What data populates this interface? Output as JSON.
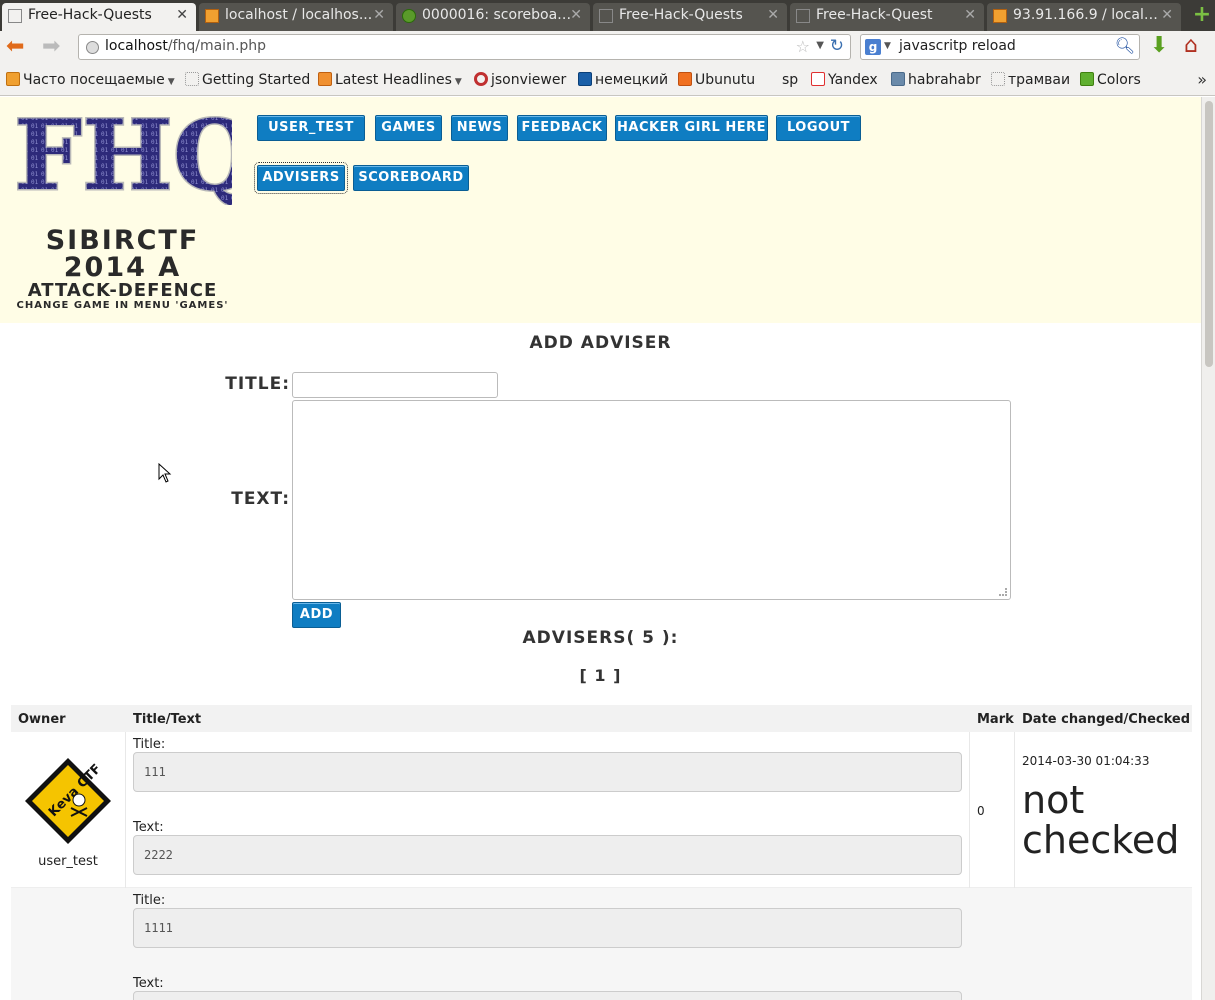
{
  "browser": {
    "tabs": [
      {
        "title": "Free-Hack-Quests",
        "icon": "blank-page-icon",
        "active": true
      },
      {
        "title": "localhost / localhos...",
        "icon": "phpmyadmin-icon"
      },
      {
        "title": "0000016: scoreboar...",
        "icon": "bug-icon"
      },
      {
        "title": "Free-Hack-Quests",
        "icon": "blank-page-icon"
      },
      {
        "title": "Free-Hack-Quest",
        "icon": "blank-page-icon"
      },
      {
        "title": "93.91.166.9 / localh...",
        "icon": "phpmyadmin-icon"
      }
    ],
    "url_host": "localhost",
    "url_path": "/fhq/main.php",
    "search_text": "javascritp reload",
    "bookmarks": [
      {
        "label": "Часто посещаемые",
        "icon": "rss-folder-icon",
        "dropdown": true
      },
      {
        "label": "Getting Started",
        "icon": "blank-page-icon"
      },
      {
        "label": "Latest Headlines",
        "icon": "rss-icon",
        "dropdown": true
      },
      {
        "label": "jsonviewer",
        "icon": "jsonviewer-icon"
      },
      {
        "label": "немецкий",
        "icon": "b-icon"
      },
      {
        "label": "Ubunutu",
        "icon": "blogger-icon"
      },
      {
        "label": "sp",
        "icon": "cart-icon"
      },
      {
        "label": "Yandex",
        "icon": "yandex-icon"
      },
      {
        "label": "habrahabr",
        "icon": "habr-icon"
      },
      {
        "label": "трамваи",
        "icon": "blank-page-icon"
      },
      {
        "label": "Colors",
        "icon": "colors-icon"
      }
    ]
  },
  "header": {
    "logo_text": "FHQ",
    "nav_row1": [
      "USER_TEST",
      "GAMES",
      "NEWS",
      "FEEDBACK",
      "HACKER GIRL HERE",
      "LOGOUT"
    ],
    "nav_row2": [
      "ADVISERS",
      "SCOREBOARD"
    ],
    "game_name": "SIBIRCTF",
    "game_year": "2014 A",
    "game_type": "ATTACK-DEFENCE",
    "game_hint": "CHANGE GAME IN MENU 'GAMES'"
  },
  "form": {
    "heading": "ADD ADVISER",
    "title_label": "TITLE:",
    "text_label": "TEXT:",
    "add_label": "ADD",
    "title_value": "",
    "text_value": ""
  },
  "list": {
    "heading": "ADVISERS( 5 ):",
    "pages": "[ 1 ]",
    "columns": [
      "Owner",
      "Title/Text",
      "Mark",
      "Date changed/Checked"
    ],
    "rows": [
      {
        "owner": "user_test",
        "badge_text": "Keva CTF",
        "title_label": "Title:",
        "title": "111",
        "text_label": "Text:",
        "text": "2222",
        "mark": "0",
        "date": "2014-03-30 01:04:33",
        "status": "not checked"
      },
      {
        "title_label": "Title:",
        "title": "1111",
        "text_label": "Text:"
      }
    ]
  },
  "colors": {
    "header_bg": "#fffde6",
    "button_bg": "#0f7dc2",
    "table_header_bg": "#f2f2f2"
  }
}
